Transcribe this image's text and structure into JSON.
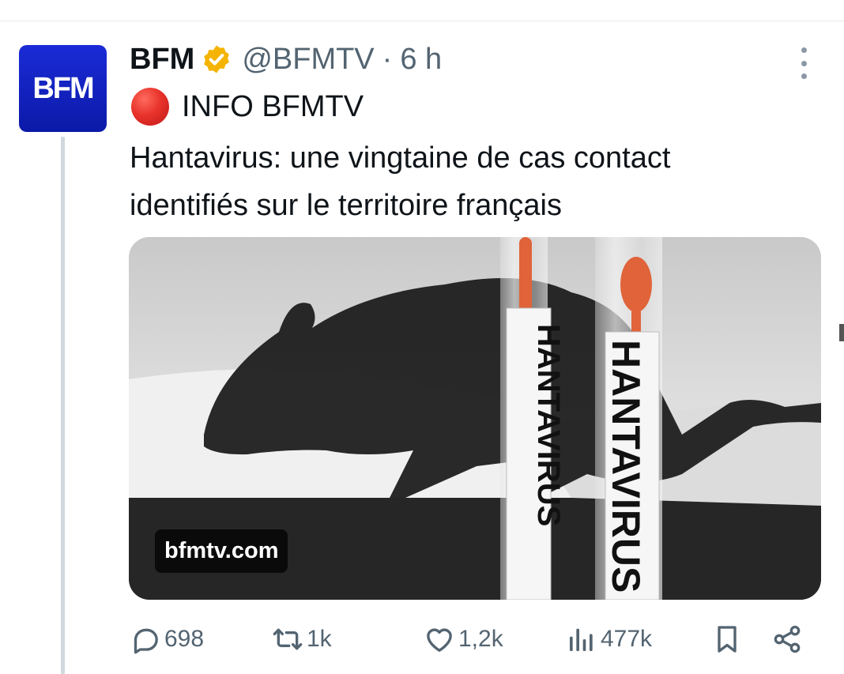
{
  "tweet": {
    "author": {
      "display_name": "BFM",
      "handle": "@BFMTV",
      "separator": "·",
      "time": "6 h",
      "avatar_text": "BFM",
      "verified_color": "#f4b400"
    },
    "info_label": "INFO BFMTV",
    "body_lines": [
      "Hantavirus: une vingtaine de cas contact",
      "identifiés sur le territoire français"
    ],
    "media": {
      "source": "bfmtv.com",
      "tube_label": "HANTAVIRUS"
    },
    "actions": {
      "replies": "698",
      "reposts": "1k",
      "likes": "1,2k",
      "views": "477k"
    }
  },
  "icons": {
    "more": "more-vertical-icon",
    "verified": "verified-badge-icon",
    "info": "red-circle-icon",
    "reply": "reply-icon",
    "repost": "repost-icon",
    "like": "heart-icon",
    "views": "views-icon",
    "bookmark": "bookmark-icon",
    "share": "share-icon"
  },
  "colors": {
    "avatar_bg": "#1a2bd6",
    "text_primary": "#0f1419",
    "text_secondary": "#536471",
    "thread_line": "#cfd9de"
  }
}
